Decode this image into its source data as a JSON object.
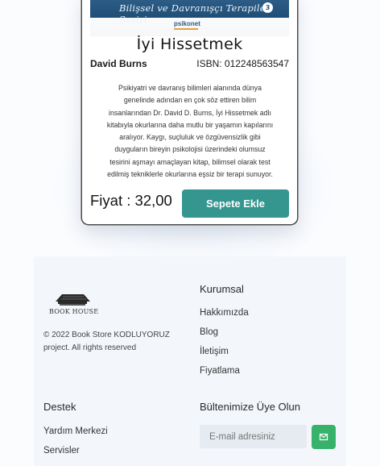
{
  "book": {
    "cover_series": "Bilişsel ve Davranışçı Terapiler Serisi",
    "cover_number": "3",
    "cover_publisher": "psikonet",
    "title": "İyi Hissetmek",
    "author": "David Burns",
    "isbn": "ISBN: 012248563547",
    "description_lines": [
      "Psikiyatri ve davranış bilimleri alanında dünya",
      "genelinde adından en çok söz ettiren bilim",
      "insanlarından Dr. David D. Burns, İyi Hissetmek adlı",
      "kitabıyla okurlarına daha mutlu bir yaşamın kapılarını",
      "aralıyor. Kaygı, suçluluk ve özgüvensizlik gibi",
      "duyguların bireyin psikolojisi üzerindeki olumsuz",
      "tesirini aşmayı amaçlayan kitap, bilimsel olarak test",
      "edilmiş tekniklerle okurlarına eşsiz bir terapi sunuyor."
    ],
    "price": "Fiyat : 32,00",
    "add_to_cart": "Sepete Ekle"
  },
  "footer": {
    "logo_text": "BOOK HOUSE",
    "copyright": "© 2022 Book Store KODLUYORUZ project. All rights reserved",
    "corporate": {
      "heading": "Kurumsal",
      "links": [
        "Hakkımızda",
        "Blog",
        "İletişim",
        "Fiyatlama"
      ]
    },
    "support": {
      "heading": "Destek",
      "links": [
        "Yardım Merkezi",
        "Servisler"
      ]
    },
    "newsletter": {
      "heading": "Bültenimize Üye Olun",
      "placeholder": "E-mail adresiniz",
      "button_icon": "envelope-icon"
    }
  },
  "colors": {
    "accent": "#35958f",
    "subscribe": "#36b26b",
    "footer_bg": "#f3f7fc"
  }
}
